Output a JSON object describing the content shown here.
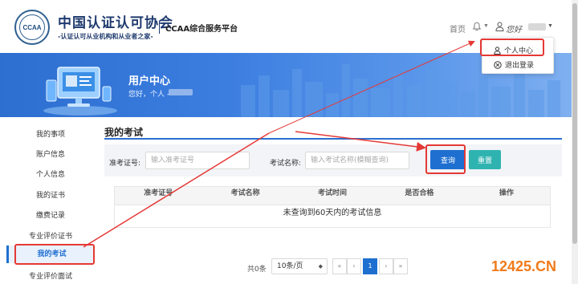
{
  "header": {
    "logo_text": "CCAA",
    "org_name": "中国认证认可协会",
    "org_slogan": "-认证认可从业机构和从业者之家-",
    "platform": "CCAA综合服务平台",
    "nav_home": "首页",
    "user_greeting": "您好",
    "bell_icon": "bell-icon",
    "user_icon": "user-icon"
  },
  "dropdown": {
    "profile_label": "个人中心",
    "logout_label": "退出登录"
  },
  "banner": {
    "title": "用户中心",
    "subtitle": "您好，个人 -"
  },
  "sidebar": {
    "items": [
      {
        "label": "我的事项"
      },
      {
        "label": "账户信息"
      },
      {
        "label": "个人信息"
      },
      {
        "label": "我的证书"
      },
      {
        "label": "缴费记录"
      },
      {
        "label": "专业评价证书"
      },
      {
        "label": "我的考试",
        "active": true
      },
      {
        "label": "专业评价面试"
      }
    ]
  },
  "main": {
    "title": "我的考试",
    "search": {
      "ticket_label": "准考证号:",
      "ticket_placeholder": "输入准考证号",
      "exam_label": "考试名称:",
      "exam_placeholder": "输入考试名称(模糊查询)",
      "query_button": "查询",
      "reset_button": "重置"
    },
    "table": {
      "columns": [
        "准考证号",
        "考试名称",
        "考试时间",
        "是否合格",
        "操作"
      ],
      "empty_text": "未查询到60天内的考试信息"
    },
    "pagination": {
      "total": "共0条",
      "page_size": "10条/页",
      "first": "«",
      "prev": "‹",
      "current": "1",
      "next": "›",
      "last": "»"
    }
  },
  "watermark": "12425.CN",
  "colors": {
    "primary": "#1f6fd1",
    "reset": "#2fb3b0",
    "highlight": "#e53935",
    "brand": "#1e3a6e"
  }
}
